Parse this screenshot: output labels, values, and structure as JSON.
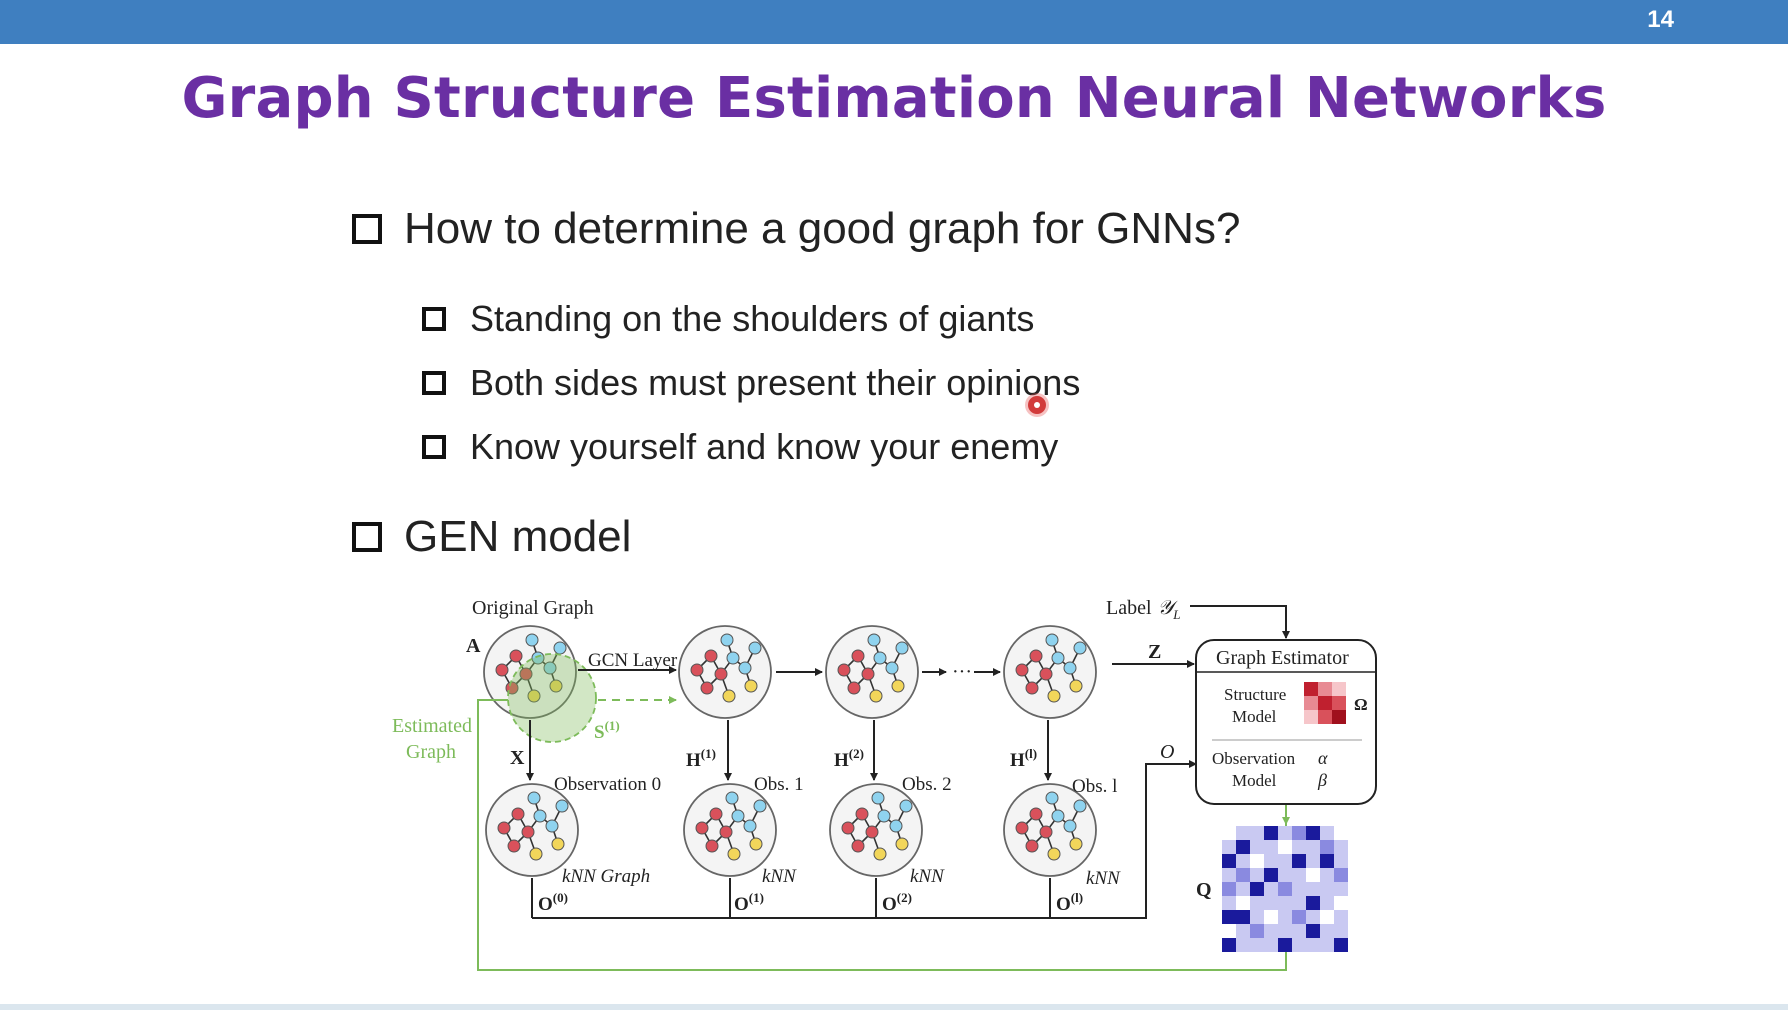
{
  "header": {
    "page_number": "14",
    "accent": "#3f7fc0"
  },
  "slide": {
    "title": "Graph Structure Estimation Neural Networks",
    "title_color": "#6a2fa3",
    "bullets": [
      {
        "text": "How to determine a good graph for GNNs?"
      },
      {
        "text": "GEN model"
      }
    ],
    "sub_bullets": [
      {
        "text": "Standing on the shoulders of giants"
      },
      {
        "text": "Both sides must present their opinions"
      },
      {
        "text": "Know yourself and know your enemy"
      }
    ]
  },
  "figure": {
    "original_graph": "Original Graph",
    "A": "A",
    "X": "X",
    "gcn_layer": "GCN Layer",
    "s1": "S",
    "s1_sup": "(1)",
    "estimated": "Estimated",
    "graph": "Graph",
    "observation0": "Observation 0",
    "obs1": "Obs. 1",
    "obs2": "Obs. 2",
    "obsl": "Obs. l",
    "h1": "H",
    "h1_sup": "(1)",
    "h2": "H",
    "h2_sup": "(2)",
    "hl": "H",
    "hl_sup": "(l)",
    "knn_graph": "kNN Graph",
    "knn": "kNN",
    "o0": "O",
    "o0_sup": "(0)",
    "o1": "O",
    "o1_sup": "(1)",
    "o2": "O",
    "o2_sup": "(2)",
    "ol": "O",
    "ol_sup": "(l)",
    "label": "Label",
    "label_y": "𝒴",
    "label_sub": "L",
    "Z": "Z",
    "O_script": "O",
    "dots": "···",
    "graph_estimator": "Graph Estimator",
    "structure_model_1": "Structure",
    "structure_model_2": "Model",
    "omega": "Ω",
    "observation_model_1": "Observation",
    "observation_model_2": "Model",
    "alpha": "α",
    "beta": "β",
    "Q": "Q",
    "colors": {
      "red_node": "#d9515b",
      "blue_node": "#8fd3ef",
      "yellow_node": "#f2d65a",
      "green": "#7dbb5a",
      "omega_dark": "#c0202f",
      "q_dark": "#1a1a9c"
    }
  }
}
